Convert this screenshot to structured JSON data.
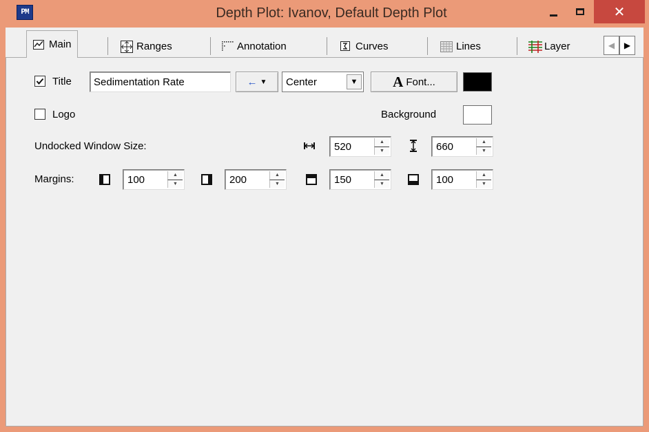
{
  "window": {
    "app_icon": "PM",
    "title": "Depth Plot: Ivanov,  Default Depth Plot",
    "controls": {
      "minimize": "minimize-icon",
      "maximize": "maximize-icon",
      "close": "✕"
    }
  },
  "tabs": [
    {
      "label": "Main",
      "icon": "line-chart-icon",
      "active": true
    },
    {
      "label": "Ranges",
      "icon": "ranges-grid-icon"
    },
    {
      "label": "Annotation",
      "icon": "annotation-dots-icon"
    },
    {
      "label": "Curves",
      "icon": "curves-icon"
    },
    {
      "label": "Lines",
      "icon": "lines-grid-icon"
    },
    {
      "label": "Layer",
      "icon": "layer-icon"
    }
  ],
  "main": {
    "title_checkbox_checked": true,
    "title_label": "Title",
    "title_value": "Sedimentation Rate",
    "alignment_arrow": "←",
    "alignment_value": "Center",
    "font_button_label": "Font...",
    "font_button_glyph": "A",
    "title_color": "#000000",
    "logo_checkbox_checked": false,
    "logo_label": "Logo",
    "background_label": "Background",
    "background_color": "#ffffff",
    "undocked_label": "Undocked Window Size:",
    "width_value": "520",
    "height_value": "660",
    "margins_label": "Margins:",
    "margin_left": "100",
    "margin_right": "200",
    "margin_top": "150",
    "margin_bottom": "100"
  }
}
